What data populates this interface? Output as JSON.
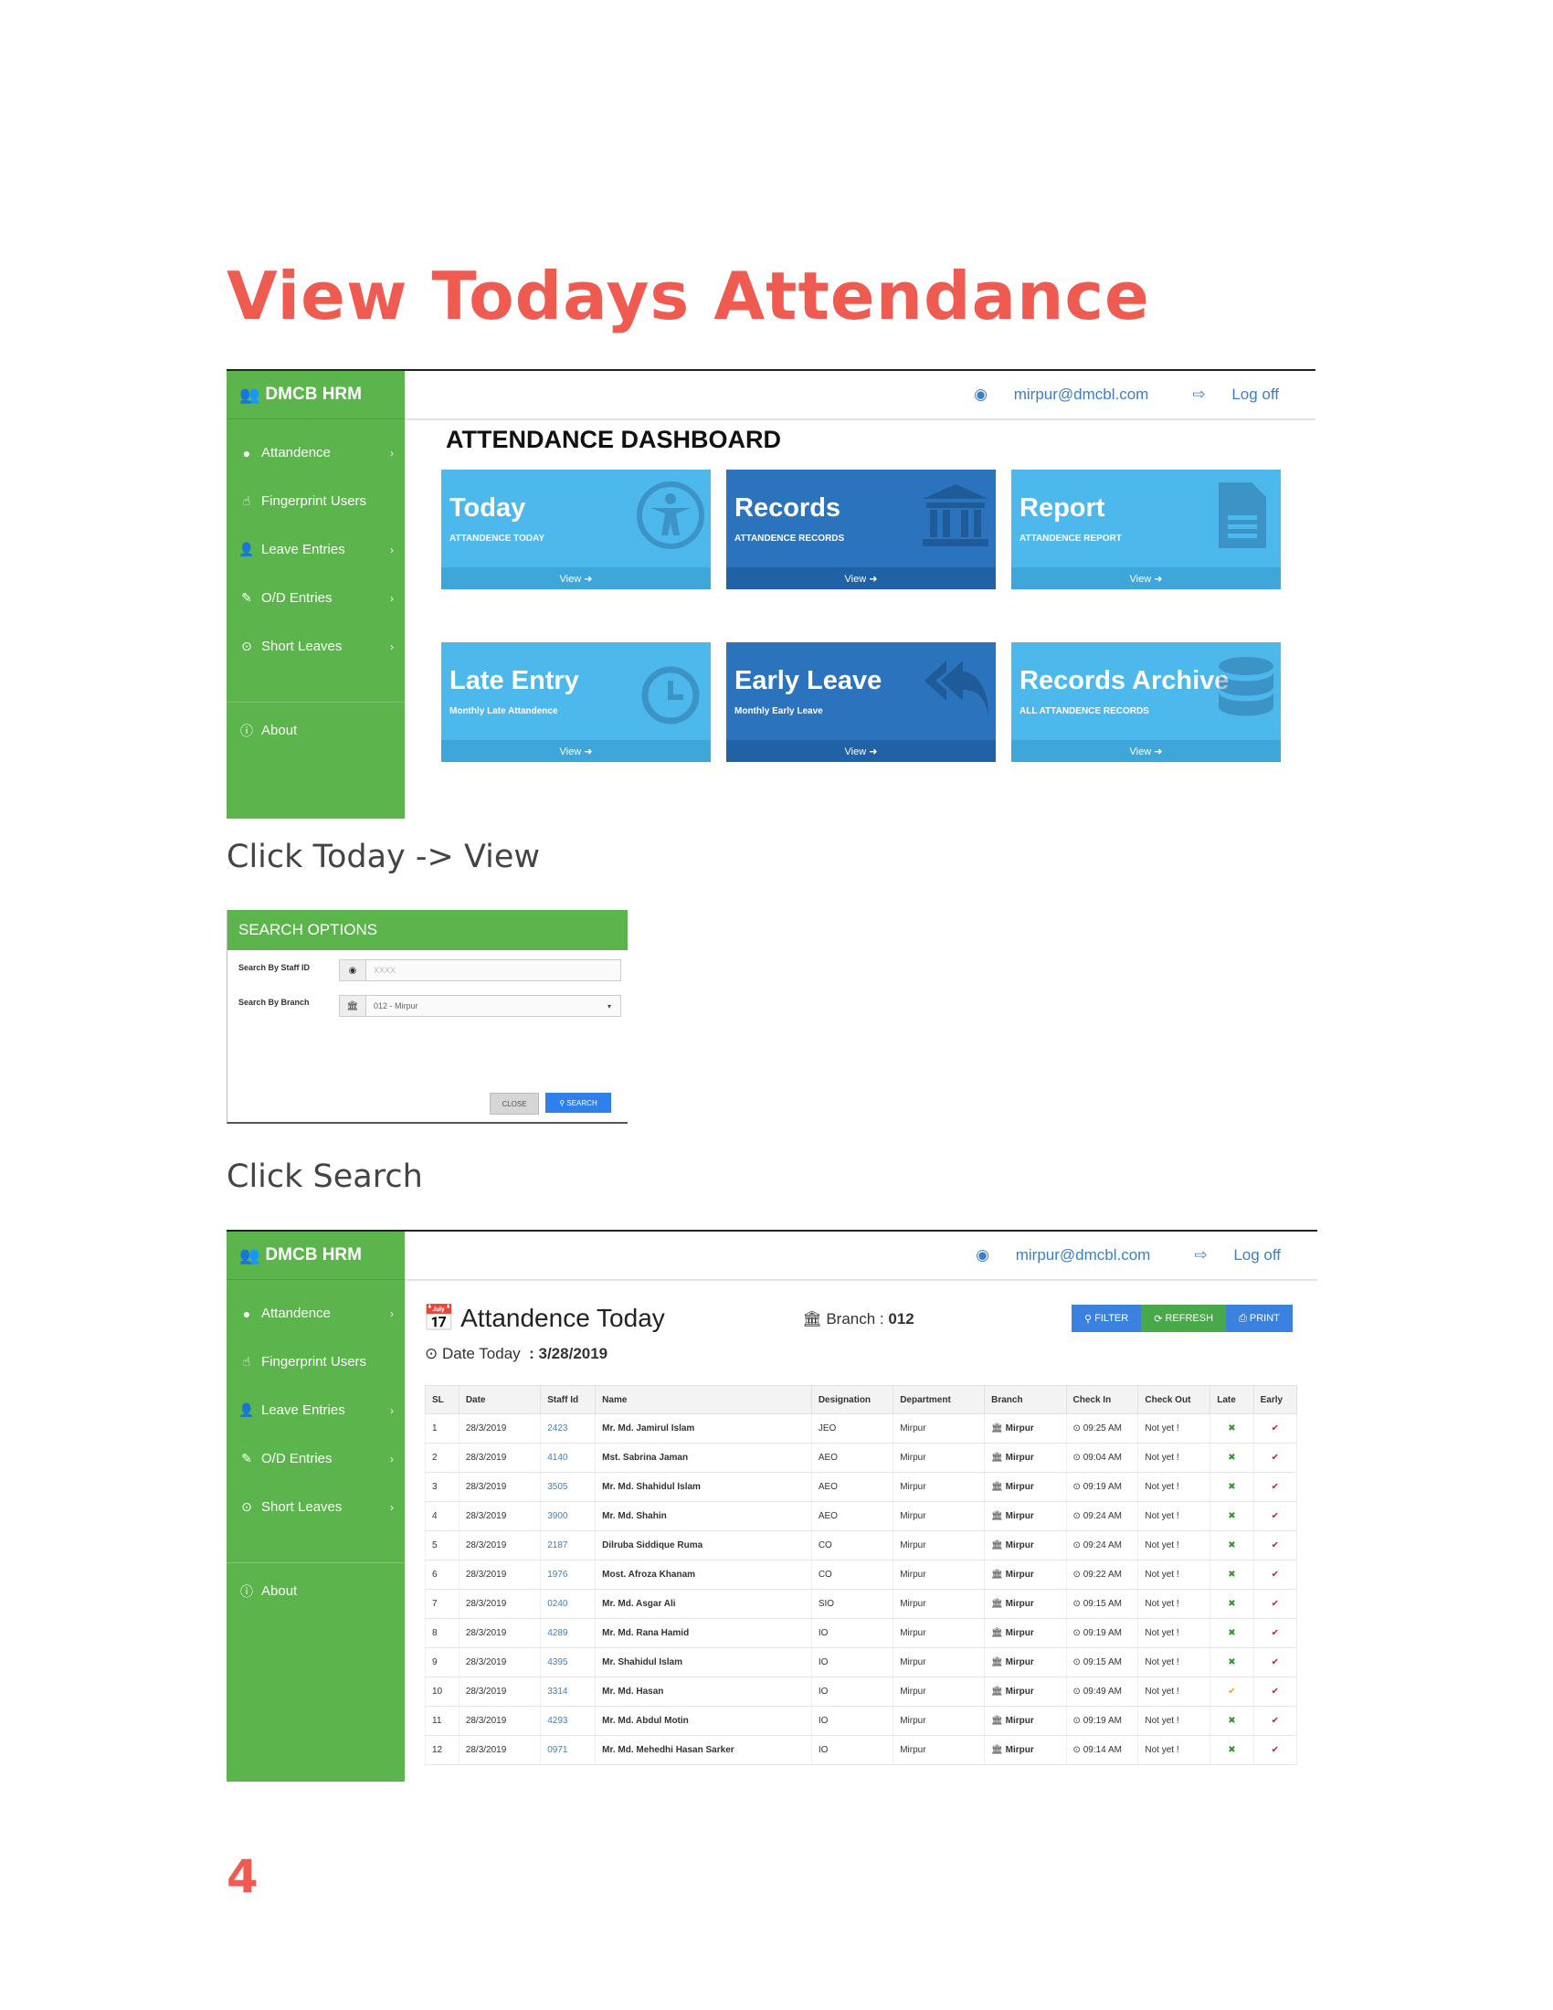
{
  "doc": {
    "title": "View Todays Attendance",
    "caption1": "Click Today -> View",
    "caption2": "Click Search",
    "page_number": "4"
  },
  "app": {
    "brand": "DMCB HRM",
    "user_email": "mirpur@dmcbl.com",
    "logoff": "Log off",
    "nav": [
      {
        "label": "Attandence",
        "icon": "info-circle-icon",
        "chevron": "›"
      },
      {
        "label": "Fingerprint Users",
        "icon": "hand-pointer-icon",
        "chevron": ""
      },
      {
        "label": "Leave Entries",
        "icon": "user-check-icon",
        "chevron": "›"
      },
      {
        "label": "O/D Entries",
        "icon": "edit-icon",
        "chevron": "›"
      },
      {
        "label": "Short Leaves",
        "icon": "clock-icon",
        "chevron": "›"
      },
      {
        "label": "About",
        "icon": "info-icon",
        "chevron": ""
      }
    ]
  },
  "dashboard": {
    "title": "ATTENDANCE DASHBOARD",
    "tiles": [
      {
        "title": "Today",
        "subtitle": "ATTANDENCE TODAY",
        "footer": "View ➜",
        "icon": "accessibility-icon"
      },
      {
        "title": "Records",
        "subtitle": "ATTANDENCE RECORDS",
        "footer": "View ➜",
        "icon": "bank-icon"
      },
      {
        "title": "Report",
        "subtitle": "ATTANDENCE REPORT",
        "footer": "View ➜",
        "icon": "document-icon"
      },
      {
        "title": "Late Entry",
        "subtitle": "Monthly Late Attandence",
        "footer": "View ➜",
        "icon": "clock-icon"
      },
      {
        "title": "Early Leave",
        "subtitle": "Monthly Early Leave",
        "footer": "View ➜",
        "icon": "reply-all-icon"
      },
      {
        "title": "Records Archive",
        "subtitle": "ALL ATTANDENCE RECORDS",
        "footer": "View ➜",
        "icon": "database-icon"
      }
    ]
  },
  "search_options": {
    "title": "SEARCH OPTIONS",
    "staff_label": "Search By Staff ID",
    "staff_placeholder": "XXXX",
    "branch_label": "Search By Branch",
    "branch_value": "012 - Mirpur",
    "close_label": "CLOSE",
    "search_label": "SEARCH"
  },
  "attendance": {
    "title": "Attandence Today",
    "date_label": "Date Today",
    "date_value": ": 3/28/2019",
    "branch_label": "Branch :",
    "branch_value": "012",
    "buttons": {
      "filter": "FILTER",
      "refresh": "REFRESH",
      "print": "PRINT"
    },
    "columns": [
      "SL",
      "Date",
      "Staff Id",
      "Name",
      "Designation",
      "Department",
      "Branch",
      "Check In",
      "Check Out",
      "Late",
      "Early"
    ],
    "rows": [
      {
        "sl": "1",
        "date": "28/3/2019",
        "staff_id": "2423",
        "name": "Mr. Md. Jamirul Islam",
        "designation": "JEO",
        "department": "Mirpur",
        "branch": "Mirpur",
        "check_in": "09:25 AM",
        "check_out": "Not yet !",
        "late": "✖",
        "early": "✔"
      },
      {
        "sl": "2",
        "date": "28/3/2019",
        "staff_id": "4140",
        "name": "Mst. Sabrina Jaman",
        "designation": "AEO",
        "department": "Mirpur",
        "branch": "Mirpur",
        "check_in": "09:04 AM",
        "check_out": "Not yet !",
        "late": "✖",
        "early": "✔"
      },
      {
        "sl": "3",
        "date": "28/3/2019",
        "staff_id": "3505",
        "name": "Mr. Md. Shahidul Islam",
        "designation": "AEO",
        "department": "Mirpur",
        "branch": "Mirpur",
        "check_in": "09:19 AM",
        "check_out": "Not yet !",
        "late": "✖",
        "early": "✔"
      },
      {
        "sl": "4",
        "date": "28/3/2019",
        "staff_id": "3900",
        "name": "Mr. Md. Shahin",
        "designation": "AEO",
        "department": "Mirpur",
        "branch": "Mirpur",
        "check_in": "09:24 AM",
        "check_out": "Not yet !",
        "late": "✖",
        "early": "✔"
      },
      {
        "sl": "5",
        "date": "28/3/2019",
        "staff_id": "2187",
        "name": "Dilruba Siddique Ruma",
        "designation": "CO",
        "department": "Mirpur",
        "branch": "Mirpur",
        "check_in": "09:24 AM",
        "check_out": "Not yet !",
        "late": "✖",
        "early": "✔"
      },
      {
        "sl": "6",
        "date": "28/3/2019",
        "staff_id": "1976",
        "name": "Most. Afroza Khanam",
        "designation": "CO",
        "department": "Mirpur",
        "branch": "Mirpur",
        "check_in": "09:22 AM",
        "check_out": "Not yet !",
        "late": "✖",
        "early": "✔"
      },
      {
        "sl": "7",
        "date": "28/3/2019",
        "staff_id": "0240",
        "name": "Mr. Md. Asgar Ali",
        "designation": "SIO",
        "department": "Mirpur",
        "branch": "Mirpur",
        "check_in": "09:15 AM",
        "check_out": "Not yet !",
        "late": "✖",
        "early": "✔"
      },
      {
        "sl": "8",
        "date": "28/3/2019",
        "staff_id": "4289",
        "name": "Mr. Md. Rana Hamid",
        "designation": "IO",
        "department": "Mirpur",
        "branch": "Mirpur",
        "check_in": "09:19 AM",
        "check_out": "Not yet !",
        "late": "✖",
        "early": "✔"
      },
      {
        "sl": "9",
        "date": "28/3/2019",
        "staff_id": "4395",
        "name": "Mr. Shahidul Islam",
        "designation": "IO",
        "department": "Mirpur",
        "branch": "Mirpur",
        "check_in": "09:15 AM",
        "check_out": "Not yet !",
        "late": "✖",
        "early": "✔"
      },
      {
        "sl": "10",
        "date": "28/3/2019",
        "staff_id": "3314",
        "name": "Mr. Md. Hasan",
        "designation": "IO",
        "department": "Mirpur",
        "branch": "Mirpur",
        "check_in": "09:49 AM",
        "check_out": "Not yet !",
        "late": "✔",
        "early": "✔"
      },
      {
        "sl": "11",
        "date": "28/3/2019",
        "staff_id": "4293",
        "name": "Mr. Md. Abdul Motin",
        "designation": "IO",
        "department": "Mirpur",
        "branch": "Mirpur",
        "check_in": "09:19 AM",
        "check_out": "Not yet !",
        "late": "✖",
        "early": "✔"
      },
      {
        "sl": "12",
        "date": "28/3/2019",
        "staff_id": "0971",
        "name": "Mr. Md. Mehedhi Hasan Sarker",
        "designation": "IO",
        "department": "Mirpur",
        "branch": "Mirpur",
        "check_in": "09:14 AM",
        "check_out": "Not yet !",
        "late": "✖",
        "early": "✔"
      }
    ]
  },
  "colors": {
    "heading_red": "#ef5b50",
    "sidebar_green": "#5cb44c",
    "tile_light_blue": "#4db8ec",
    "tile_dark_blue": "#2b73bd",
    "link_blue": "#3e7fc4"
  }
}
